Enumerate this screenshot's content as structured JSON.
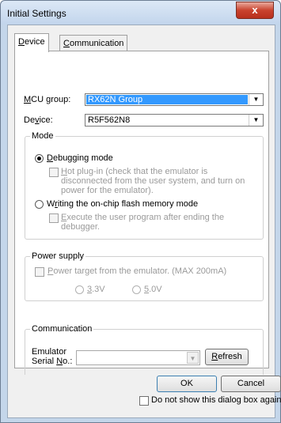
{
  "window": {
    "title": "Initial Settings",
    "close_glyph": "x"
  },
  "tabs": [
    {
      "pre": "",
      "u": "D",
      "post": "evice"
    },
    {
      "pre": "",
      "u": "C",
      "post": "ommunication"
    }
  ],
  "device": {
    "mcu_label": {
      "pre": "",
      "u": "M",
      "post": "CU group:"
    },
    "mcu_value": "RX62N Group",
    "device_label": {
      "pre": "De",
      "u": "v",
      "post": "ice:"
    },
    "device_value": "R5F562N8"
  },
  "mode": {
    "title": "Mode",
    "debug": {
      "pre": "",
      "u": "D",
      "post": "ebugging mode"
    },
    "hotplug": {
      "pre": "",
      "u": "H",
      "post": "ot plug-in (check that the emulator is"
    },
    "hotplug_lines": [
      "disconnected from the user system, and turn on",
      "power for the emulator)."
    ],
    "flash": {
      "pre": "W",
      "u": "r",
      "post": "iting the on-chip flash memory mode"
    },
    "execute": {
      "pre": "",
      "u": "E",
      "post": "xecute the user program after ending the"
    },
    "execute_line2": "debugger."
  },
  "power": {
    "title": "Power supply",
    "target": {
      "pre": "",
      "u": "P",
      "post": "ower target from the emulator. (MAX 200mA)"
    },
    "v33": {
      "pre": "",
      "u": "3",
      "post": ".3V"
    },
    "v50": {
      "pre": "",
      "u": "5",
      "post": ".0V"
    }
  },
  "communication": {
    "title": "Communication",
    "serial_label_1": "Emulator",
    "serial_label_2": {
      "pre": "Serial ",
      "u": "N",
      "post": "o.:"
    },
    "serial_value": "",
    "refresh": {
      "pre": "",
      "u": "R",
      "post": "efresh"
    }
  },
  "buttons": {
    "ok": "OK",
    "cancel": "Cancel"
  },
  "footer": {
    "dont_show": "Do not show this dialog box again."
  },
  "colors": {
    "selection": "#3399ff",
    "title_bar": "#c4d6ea",
    "close_button": "#c9432e"
  },
  "icons": {
    "dropdown": "chevron-down-icon",
    "close": "close-icon"
  }
}
